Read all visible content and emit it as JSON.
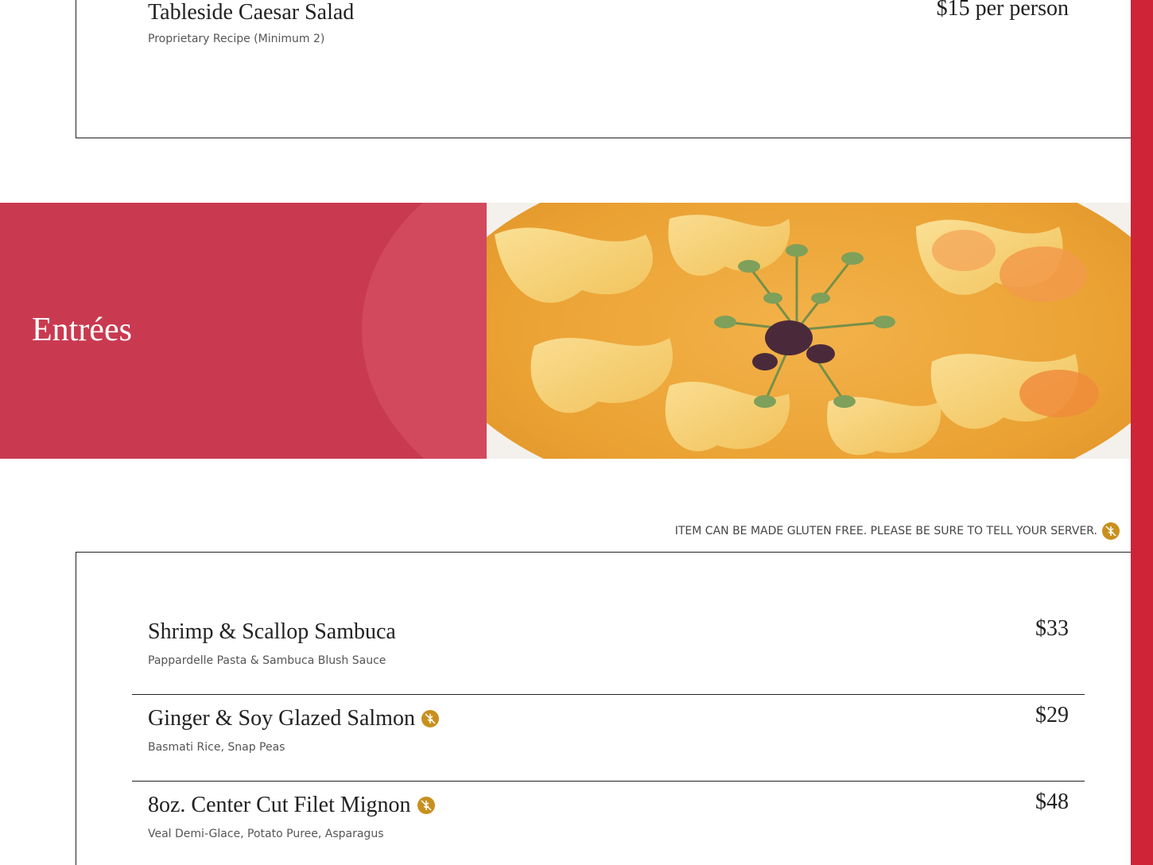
{
  "previous_section": {
    "item": {
      "name": "Tableside Caesar Salad",
      "description": "Proprietary Recipe (Minimum 2)",
      "price": "$15 per person"
    }
  },
  "banner": {
    "title": "Entrées"
  },
  "notice": {
    "text": "ITEM CAN BE MADE GLUTEN FREE. PLEASE BE SURE TO TELL YOUR SERVER.",
    "icon": "gluten-free-icon"
  },
  "entrees": {
    "items": [
      {
        "name": "Shrimp & Scallop Sambuca",
        "description": "Pappardelle Pasta & Sambuca Blush Sauce",
        "price": "$33",
        "gluten_free": false
      },
      {
        "name": "Ginger & Soy Glazed Salmon",
        "description": "Basmati Rice, Snap Peas",
        "price": "$29",
        "gluten_free": true
      },
      {
        "name": "8oz. Center Cut Filet Mignon",
        "description": "Veal Demi-Glace, Potato Puree, Asparagus",
        "price": "$48",
        "gluten_free": true
      }
    ]
  },
  "colors": {
    "accent_red": "#cf2338",
    "banner_red": "#c93a50",
    "gluten_free_gold": "#c8901e"
  }
}
